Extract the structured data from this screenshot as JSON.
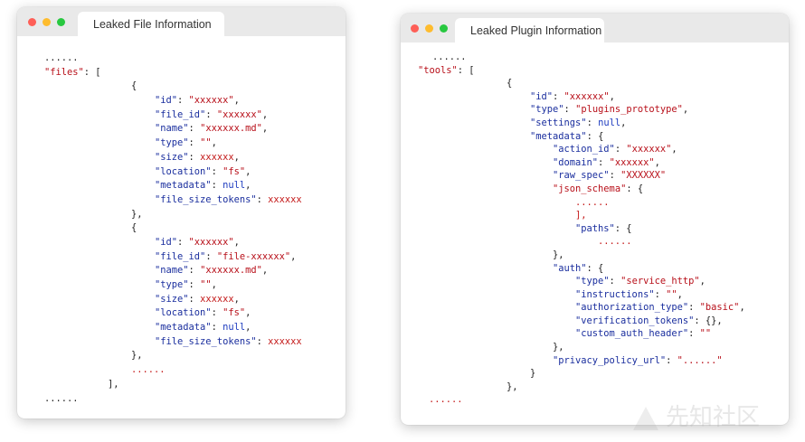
{
  "windows": [
    {
      "tab_title": "Leaked File Information",
      "lines": [
        [
          [
            "p",
            "......"
          ]
        ],
        [
          [
            "s",
            "\"files\""
          ],
          [
            "p",
            ": ["
          ]
        ],
        [
          [
            "p",
            "{"
          ]
        ],
        [
          [
            "k",
            "\"id\""
          ],
          [
            "p",
            ": "
          ],
          [
            "s",
            "\"xxxxxx\""
          ],
          [
            "p",
            ","
          ]
        ],
        [
          [
            "k",
            "\"file_id\""
          ],
          [
            "p",
            ": "
          ],
          [
            "s",
            "\"xxxxxx\""
          ],
          [
            "p",
            ","
          ]
        ],
        [
          [
            "k",
            "\"name\""
          ],
          [
            "p",
            ": "
          ],
          [
            "s",
            "\"xxxxxx.md\""
          ],
          [
            "p",
            ","
          ]
        ],
        [
          [
            "k",
            "\"type\""
          ],
          [
            "p",
            ": "
          ],
          [
            "s",
            "\"\""
          ],
          [
            "p",
            ","
          ]
        ],
        [
          [
            "k",
            "\"size\""
          ],
          [
            "p",
            ": "
          ],
          [
            "r",
            "xxxxxx"
          ],
          [
            "p",
            ","
          ]
        ],
        [
          [
            "k",
            "\"location\""
          ],
          [
            "p",
            ": "
          ],
          [
            "s",
            "\"fs\""
          ],
          [
            "p",
            ","
          ]
        ],
        [
          [
            "k",
            "\"metadata\""
          ],
          [
            "p",
            ": "
          ],
          [
            "l",
            "null"
          ],
          [
            "p",
            ","
          ]
        ],
        [
          [
            "k",
            "\"file_size_tokens\""
          ],
          [
            "p",
            ": "
          ],
          [
            "r",
            "xxxxxx"
          ]
        ],
        [
          [
            "p",
            "},"
          ]
        ],
        [
          [
            "p",
            "{"
          ]
        ],
        [
          [
            "k",
            "\"id\""
          ],
          [
            "p",
            ": "
          ],
          [
            "s",
            "\"xxxxxx\""
          ],
          [
            "p",
            ","
          ]
        ],
        [
          [
            "k",
            "\"file_id\""
          ],
          [
            "p",
            ": "
          ],
          [
            "s",
            "\"file-xxxxxx\""
          ],
          [
            "p",
            ","
          ]
        ],
        [
          [
            "k",
            "\"name\""
          ],
          [
            "p",
            ": "
          ],
          [
            "s",
            "\"xxxxxx.md\""
          ],
          [
            "p",
            ","
          ]
        ],
        [
          [
            "k",
            "\"type\""
          ],
          [
            "p",
            ": "
          ],
          [
            "s",
            "\"\""
          ],
          [
            "p",
            ","
          ]
        ],
        [
          [
            "k",
            "\"size\""
          ],
          [
            "p",
            ": "
          ],
          [
            "r",
            "xxxxxx"
          ],
          [
            "p",
            ","
          ]
        ],
        [
          [
            "k",
            "\"location\""
          ],
          [
            "p",
            ": "
          ],
          [
            "s",
            "\"fs\""
          ],
          [
            "p",
            ","
          ]
        ],
        [
          [
            "k",
            "\"metadata\""
          ],
          [
            "p",
            ": "
          ],
          [
            "l",
            "null"
          ],
          [
            "p",
            ","
          ]
        ],
        [
          [
            "k",
            "\"file_size_tokens\""
          ],
          [
            "p",
            ": "
          ],
          [
            "r",
            "xxxxxx"
          ]
        ],
        [
          [
            "p",
            "},"
          ]
        ],
        [
          [
            "r",
            "......"
          ]
        ],
        [
          [
            "p",
            "],"
          ]
        ],
        [
          [
            "p",
            "......"
          ]
        ]
      ]
    },
    {
      "tab_title": "Leaked Plugin Information",
      "lines": [
        [
          [
            "p",
            "......"
          ]
        ],
        [
          [
            "s",
            "\"tools\""
          ],
          [
            "p",
            ": ["
          ]
        ],
        [
          [
            "p",
            "{"
          ]
        ],
        [
          [
            "k",
            "\"id\""
          ],
          [
            "p",
            ": "
          ],
          [
            "s",
            "\"xxxxxx\""
          ],
          [
            "p",
            ","
          ]
        ],
        [
          [
            "k",
            "\"type\""
          ],
          [
            "p",
            ": "
          ],
          [
            "s",
            "\"plugins_prototype\""
          ],
          [
            "p",
            ","
          ]
        ],
        [
          [
            "k",
            "\"settings\""
          ],
          [
            "p",
            ": "
          ],
          [
            "l",
            "null"
          ],
          [
            "p",
            ","
          ]
        ],
        [
          [
            "k",
            "\"metadata\""
          ],
          [
            "p",
            ": {"
          ]
        ],
        [
          [
            "k",
            "\"action_id\""
          ],
          [
            "p",
            ": "
          ],
          [
            "s",
            "\"xxxxxx\""
          ],
          [
            "p",
            ","
          ]
        ],
        [
          [
            "k",
            "\"domain\""
          ],
          [
            "p",
            ": "
          ],
          [
            "s",
            "\"xxxxxx\""
          ],
          [
            "p",
            ","
          ]
        ],
        [
          [
            "k",
            "\"raw_spec\""
          ],
          [
            "p",
            ": "
          ],
          [
            "s",
            "\"XXXXXX\""
          ]
        ],
        [
          [
            "s",
            "\"json_schema\""
          ],
          [
            "p",
            ": {"
          ]
        ],
        [
          [
            "r",
            "......"
          ]
        ],
        [
          [
            "r",
            "],"
          ]
        ],
        [
          [
            "k",
            "\"paths\""
          ],
          [
            "p",
            ": {"
          ]
        ],
        [
          [
            "r",
            "......"
          ]
        ],
        [
          [
            "p",
            "},"
          ]
        ],
        [
          [
            "k",
            "\"auth\""
          ],
          [
            "p",
            ": {"
          ]
        ],
        [
          [
            "k",
            "\"type\""
          ],
          [
            "p",
            ": "
          ],
          [
            "s",
            "\"service_http\""
          ],
          [
            "p",
            ","
          ]
        ],
        [
          [
            "k",
            "\"instructions\""
          ],
          [
            "p",
            ": "
          ],
          [
            "s",
            "\"\""
          ],
          [
            "p",
            ","
          ]
        ],
        [
          [
            "k",
            "\"authorization_type\""
          ],
          [
            "p",
            ": "
          ],
          [
            "s",
            "\"basic\""
          ],
          [
            "p",
            ","
          ]
        ],
        [
          [
            "k",
            "\"verification_tokens\""
          ],
          [
            "p",
            ": {},"
          ]
        ],
        [
          [
            "k",
            "\"custom_auth_header\""
          ],
          [
            "p",
            ": "
          ],
          [
            "s",
            "\"\""
          ]
        ],
        [
          [
            "p",
            "},"
          ]
        ],
        [
          [
            "k",
            "\"privacy_policy_url\""
          ],
          [
            "p",
            ": "
          ],
          [
            "s",
            "\"......\""
          ]
        ],
        [
          [
            "p",
            "}"
          ]
        ],
        [
          [
            "p",
            "},"
          ]
        ],
        [
          [
            "r",
            "......"
          ]
        ]
      ]
    }
  ],
  "colors": {
    "key": "#1a2e9e",
    "string": "#b8101a",
    "literal": "#1d3bbf",
    "raw": "#c41a1a",
    "punctuation": "#222222",
    "titlebar": "#e9e9e9",
    "close": "#fe5f57",
    "minimize": "#febc2e",
    "maximize": "#28c840"
  },
  "watermark": {
    "text": "先知社区",
    "logo": "xianzhi-logo-icon"
  }
}
